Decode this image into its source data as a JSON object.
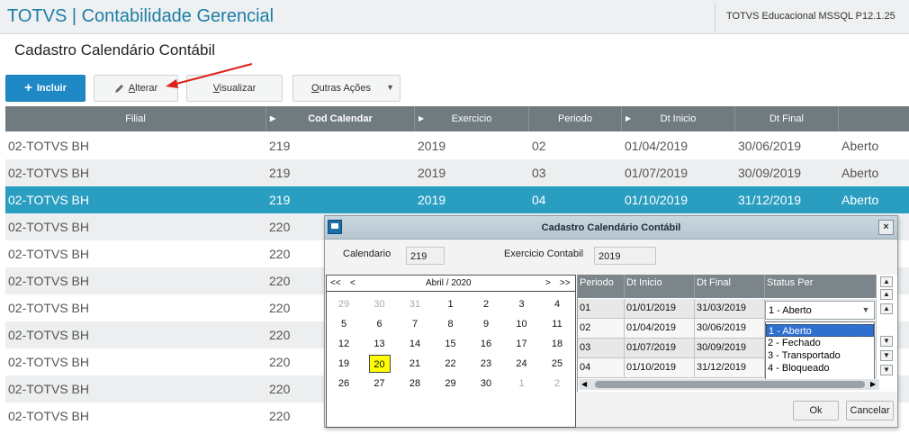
{
  "header": {
    "app_title": "TOTVS | Contabilidade Gerencial",
    "environment": "TOTVS Educacional MSSQL P12.1.25"
  },
  "page": {
    "title": "Cadastro Calendário Contábil"
  },
  "toolbar": {
    "include": "Incluir",
    "alter_first": "A",
    "alter_rest": "lterar",
    "view_first": "V",
    "view_rest": "isualizar",
    "other_first": "O",
    "other_rest": "utras Ações"
  },
  "grid": {
    "columns": [
      "Filial",
      "Cod Calendar",
      "Exercicio",
      "Periodo",
      "Dt Inicio",
      "Dt Final",
      ""
    ],
    "rows": [
      [
        "02-TOTVS BH",
        "219",
        "2019",
        "02",
        "01/04/2019",
        "30/06/2019",
        "Aberto"
      ],
      [
        "02-TOTVS BH",
        "219",
        "2019",
        "03",
        "01/07/2019",
        "30/09/2019",
        "Aberto"
      ],
      [
        "02-TOTVS BH",
        "219",
        "2019",
        "04",
        "01/10/2019",
        "31/12/2019",
        "Aberto"
      ],
      [
        "02-TOTVS BH",
        "220"
      ],
      [
        "02-TOTVS BH",
        "220"
      ],
      [
        "02-TOTVS BH",
        "220"
      ],
      [
        "02-TOTVS BH",
        "220"
      ],
      [
        "02-TOTVS BH",
        "220"
      ],
      [
        "02-TOTVS BH",
        "220"
      ],
      [
        "02-TOTVS BH",
        "220"
      ],
      [
        "02-TOTVS BH",
        "220"
      ]
    ],
    "selected_row": 2
  },
  "dialog": {
    "title": "Cadastro Calendário Contábil",
    "calendario_label": "Calendario",
    "calendario_value": "219",
    "exercicio_label": "Exercicio Contabil",
    "exercicio_value": "2019",
    "calendar": {
      "nav": [
        "<<",
        "<",
        "Abril / 2020",
        ">",
        ">>"
      ],
      "weeks": [
        [
          "29",
          "30",
          "31",
          "1",
          "2",
          "3",
          "4"
        ],
        [
          "5",
          "6",
          "7",
          "8",
          "9",
          "10",
          "11"
        ],
        [
          "12",
          "13",
          "14",
          "15",
          "16",
          "17",
          "18"
        ],
        [
          "19",
          "20",
          "21",
          "22",
          "23",
          "24",
          "25"
        ],
        [
          "26",
          "27",
          "28",
          "29",
          "30",
          "1",
          "2"
        ]
      ],
      "today": "20"
    },
    "periods": {
      "columns": [
        "Periodo",
        "Dt Inicio",
        "Dt Final",
        "Status Per"
      ],
      "rows": [
        [
          "01",
          "01/01/2019",
          "31/03/2019"
        ],
        [
          "02",
          "01/04/2019",
          "30/06/2019"
        ],
        [
          "03",
          "01/07/2019",
          "30/09/2019"
        ],
        [
          "04",
          "01/10/2019",
          "31/12/2019"
        ]
      ],
      "status_value": "1 - Aberto",
      "status_options": [
        "1 - Aberto",
        "2 - Fechado",
        "3 - Transportado",
        "4 - Bloqueado"
      ]
    },
    "ok": "Ok",
    "cancel": "Cancelar"
  },
  "colors": {
    "accent": "#1e89c4",
    "selected_row": "#2a9ec1",
    "header_bg": "#707b80",
    "annotation": "#e0201a"
  }
}
